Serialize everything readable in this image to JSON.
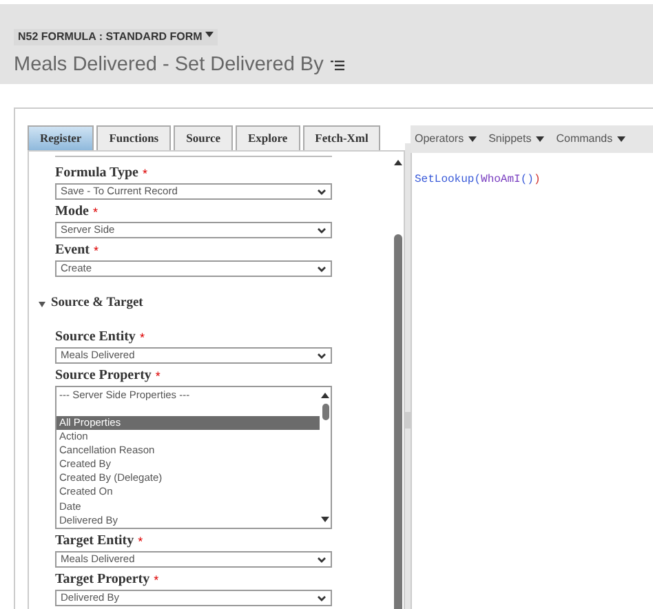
{
  "header": {
    "form_label": "N52 FORMULA : STANDARD FORM",
    "title": "Meals Delivered - Set Delivered By"
  },
  "tabs": [
    {
      "label": "Register",
      "selected": true
    },
    {
      "label": "Functions",
      "selected": false
    },
    {
      "label": "Source",
      "selected": false
    },
    {
      "label": "Explore",
      "selected": false
    },
    {
      "label": "Fetch-Xml",
      "selected": false
    }
  ],
  "fields_top": [
    {
      "label": "Formula Type",
      "required_mark": "*",
      "value": "Save - To Current Record"
    },
    {
      "label": "Mode",
      "required_mark": "*",
      "value": "Server Side"
    },
    {
      "label": "Event",
      "required_mark": "*",
      "value": "Create"
    }
  ],
  "section": {
    "title": "Source & Target",
    "expanded": true
  },
  "source_entity": {
    "label": "Source Entity",
    "required_mark": "*",
    "value": "Meals Delivered"
  },
  "source_property": {
    "label": "Source Property",
    "required_mark": "*",
    "items": [
      {
        "kind": "option",
        "label": "--- Server Side Properties ---",
        "selected": false
      },
      {
        "kind": "blank"
      },
      {
        "kind": "option",
        "label": "All Properties",
        "selected": true
      },
      {
        "kind": "option",
        "label": "Action",
        "selected": false
      },
      {
        "kind": "option",
        "label": "Cancellation Reason",
        "selected": false
      },
      {
        "kind": "option",
        "label": "Created By",
        "selected": false
      },
      {
        "kind": "option",
        "label": "Created By (Delegate)",
        "selected": false
      },
      {
        "kind": "option",
        "label": "Created On",
        "selected": false
      },
      {
        "kind": "option",
        "label": "Date",
        "selected": false
      },
      {
        "kind": "option",
        "label": "Delivered By",
        "selected": false
      }
    ]
  },
  "fields_bottom": [
    {
      "label": "Target Entity",
      "required_mark": "*",
      "value": "Meals Delivered"
    },
    {
      "label": "Target Property",
      "required_mark": "*",
      "value": "Delivered By"
    }
  ],
  "editor": {
    "menus": [
      "Operators",
      "Snippets",
      "Commands"
    ],
    "code": [
      {
        "text": "SetLookup(",
        "color": "#3a5bd9"
      },
      {
        "text": "WhoAmI",
        "color": "#7a3fc0"
      },
      {
        "text": "()",
        "color": "#3a5bd9"
      },
      {
        "text": ")",
        "color": "#d0302b"
      }
    ]
  }
}
